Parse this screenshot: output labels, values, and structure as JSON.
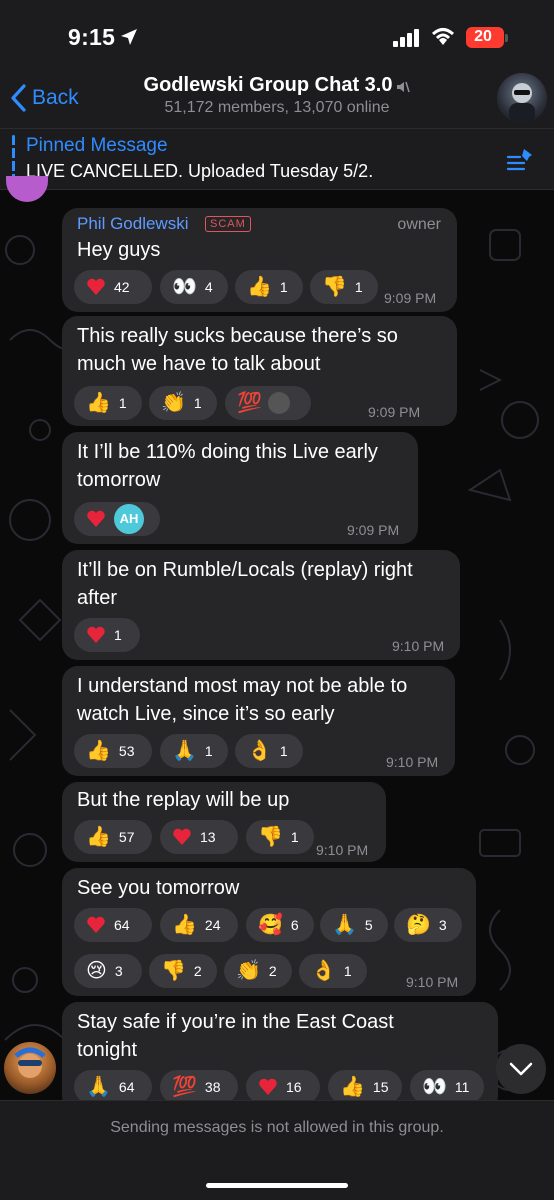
{
  "status_bar": {
    "time": "9:15",
    "battery": "20"
  },
  "header": {
    "back_label": "Back",
    "title": "Godlewski Group Chat 3.0",
    "subtitle": "51,172 members, 13,070 online"
  },
  "pinned": {
    "title": "Pinned Message",
    "text": "LIVE CANCELLED. Uploaded Tuesday 5/2."
  },
  "messages": [
    {
      "sender": "Phil Godlewski",
      "badge": "SCAM",
      "role": "owner",
      "text": "Hey guys",
      "time": "9:09 PM",
      "reactions": [
        {
          "emoji": "heart",
          "count": "42"
        },
        {
          "emoji": "👀",
          "count": "4"
        },
        {
          "emoji": "👍",
          "count": "1"
        },
        {
          "emoji": "👎",
          "count": "1"
        }
      ]
    },
    {
      "text1": "This really sucks because there’s so",
      "text2": "much we have to talk about",
      "time": "9:09 PM",
      "reactions": [
        {
          "emoji": "👍",
          "count": "1"
        },
        {
          "emoji": "👏",
          "count": "1"
        },
        {
          "emoji": "💯",
          "count": ""
        }
      ]
    },
    {
      "text1": "It I’ll be 110% doing this Live early",
      "text2": "tomorrow",
      "time": "9:09 PM",
      "reactions": [
        {
          "emoji": "heart",
          "count": "",
          "avatar": "AH"
        }
      ]
    },
    {
      "text1": "It’ll be on Rumble/Locals (replay) right",
      "text2": "after",
      "time": "9:10 PM",
      "reactions": [
        {
          "emoji": "heart",
          "count": "1"
        }
      ]
    },
    {
      "text1": "I understand most may not be able to",
      "text2": "watch Live, since it’s so early",
      "time": "9:10 PM",
      "reactions": [
        {
          "emoji": "👍",
          "count": "53"
        },
        {
          "emoji": "🙏",
          "count": "1"
        },
        {
          "emoji": "👌",
          "count": "1"
        }
      ]
    },
    {
      "text": "But the replay will be up",
      "time": "9:10 PM",
      "reactions": [
        {
          "emoji": "👍",
          "count": "57"
        },
        {
          "emoji": "heart",
          "count": "13"
        },
        {
          "emoji": "👎",
          "count": "1"
        }
      ]
    },
    {
      "text": "See you tomorrow",
      "time": "9:10 PM",
      "reactions": [
        {
          "emoji": "heart",
          "count": "64"
        },
        {
          "emoji": "👍",
          "count": "24"
        },
        {
          "emoji": "🥰",
          "count": "6"
        },
        {
          "emoji": "🙏",
          "count": "5"
        },
        {
          "emoji": "🤔",
          "count": "3"
        },
        {
          "emoji": "😢",
          "count": "3"
        },
        {
          "emoji": "👎",
          "count": "2"
        },
        {
          "emoji": "👏",
          "count": "2"
        },
        {
          "emoji": "👌",
          "count": "1"
        }
      ]
    },
    {
      "text1": "Stay safe if you’re in the East Coast",
      "text2": "tonight",
      "reactions": [
        {
          "emoji": "🙏",
          "count": "64"
        },
        {
          "emoji": "💯",
          "count": "38"
        },
        {
          "emoji": "heart",
          "count": "16"
        },
        {
          "emoji": "👍",
          "count": "15"
        },
        {
          "emoji": "👀",
          "count": "11"
        }
      ]
    }
  ],
  "footer": {
    "text": "Sending messages is not allowed in this group."
  },
  "colors": {
    "accent": "#2f8cff",
    "bubble": "#262629",
    "scam": "#e0565a",
    "heart": "#e8243a"
  }
}
